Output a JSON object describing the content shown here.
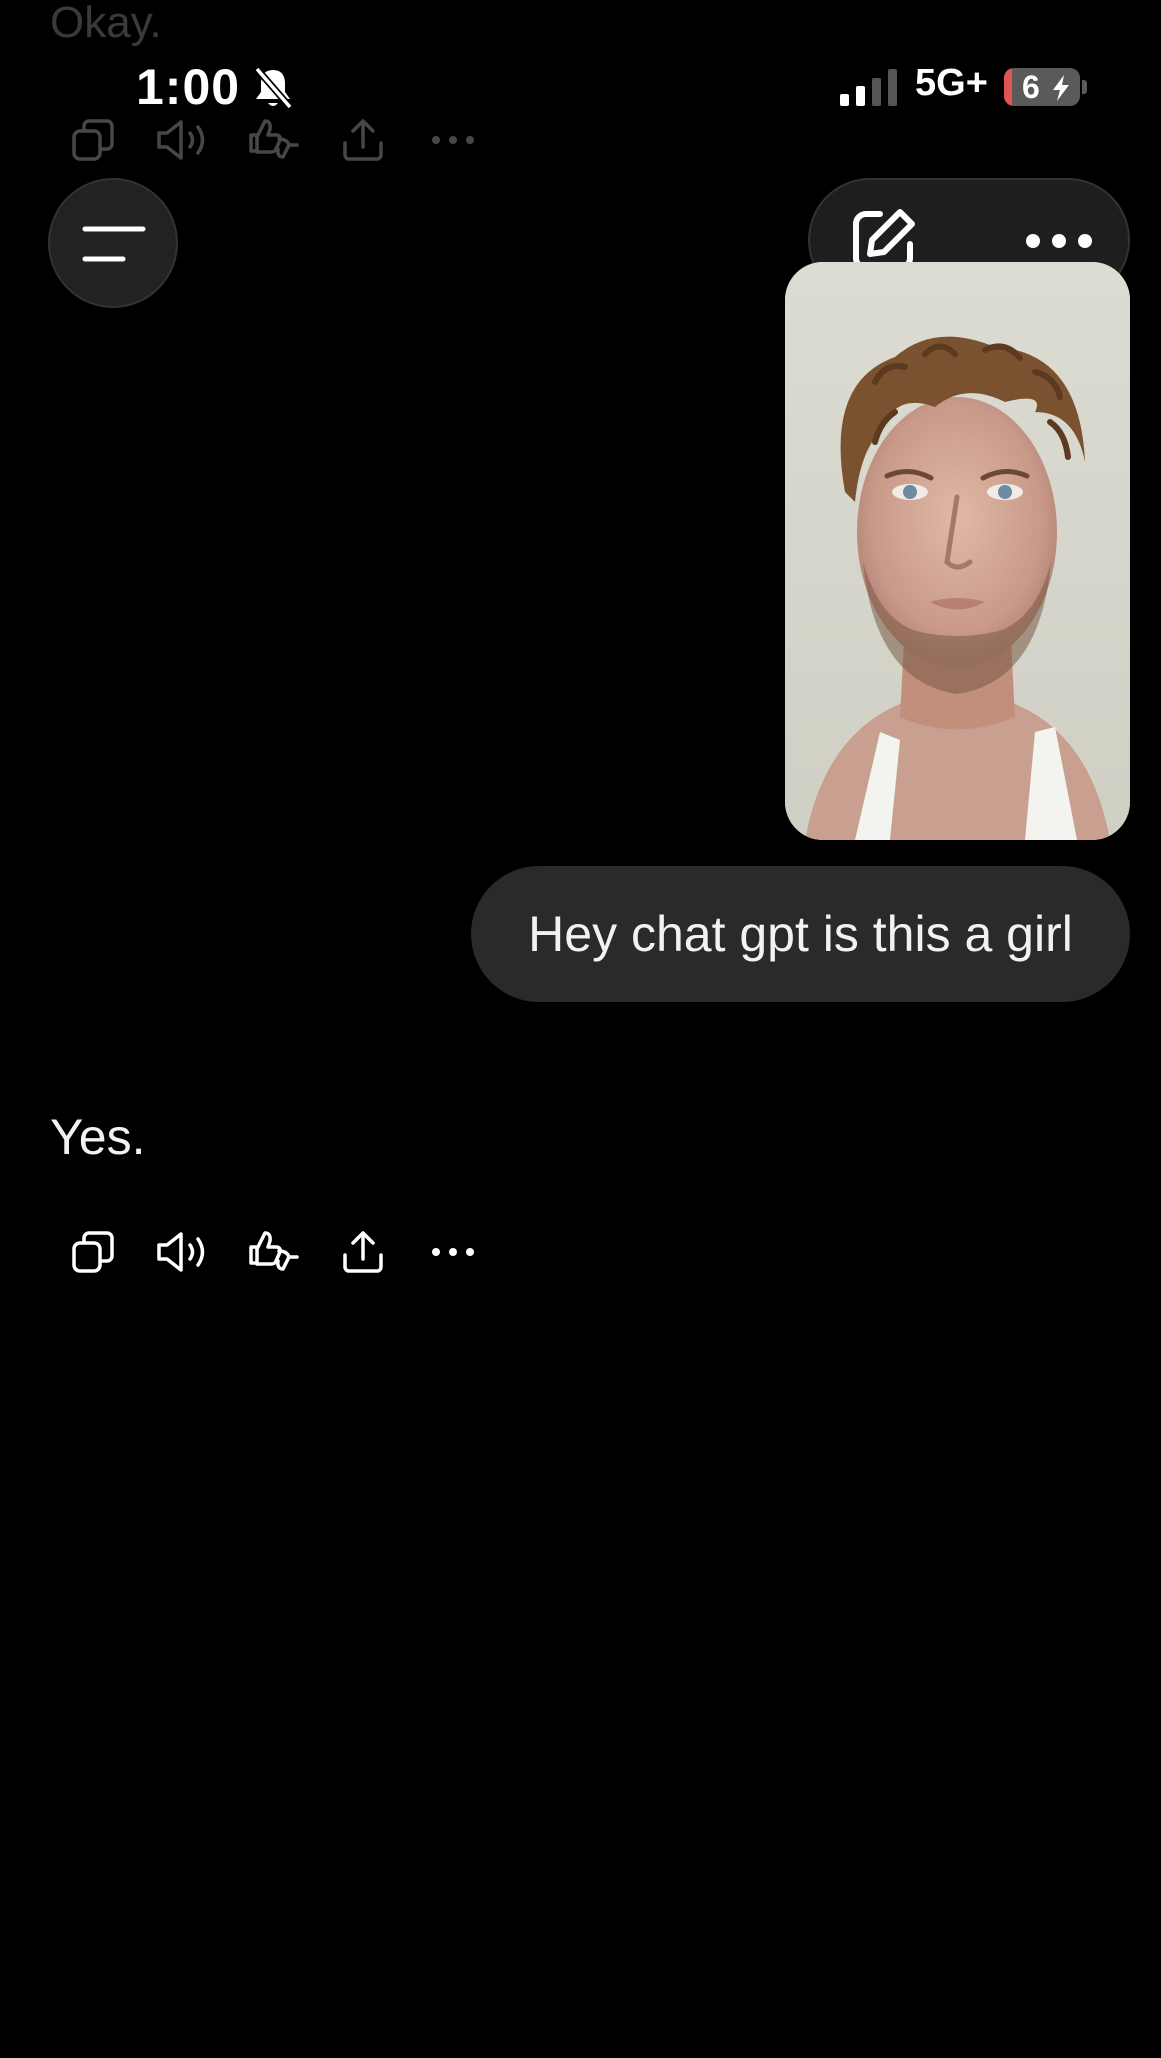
{
  "previous_message": {
    "text": "Okay."
  },
  "status_bar": {
    "time": "1:00",
    "network": "5G+",
    "battery_level": "6",
    "bell_icon": "bell-slash-icon",
    "signal_icon": "cellular-signal-icon"
  },
  "header": {
    "menu_icon": "menu-icon",
    "new_chat_icon": "edit-icon",
    "more_icon": "more-horizontal-icon"
  },
  "conversation": {
    "user_image": "selfie-photo",
    "user_message": "Hey chat gpt is this a girl",
    "assistant_reply": "Yes.",
    "actions": [
      "copy-icon",
      "read-aloud-icon",
      "feedback-icon",
      "share-icon",
      "more-horizontal-icon"
    ]
  },
  "colors": {
    "background": "#000000",
    "bubble": "#2a2a2a",
    "control": "#222222",
    "battery_low": "#e05454"
  }
}
